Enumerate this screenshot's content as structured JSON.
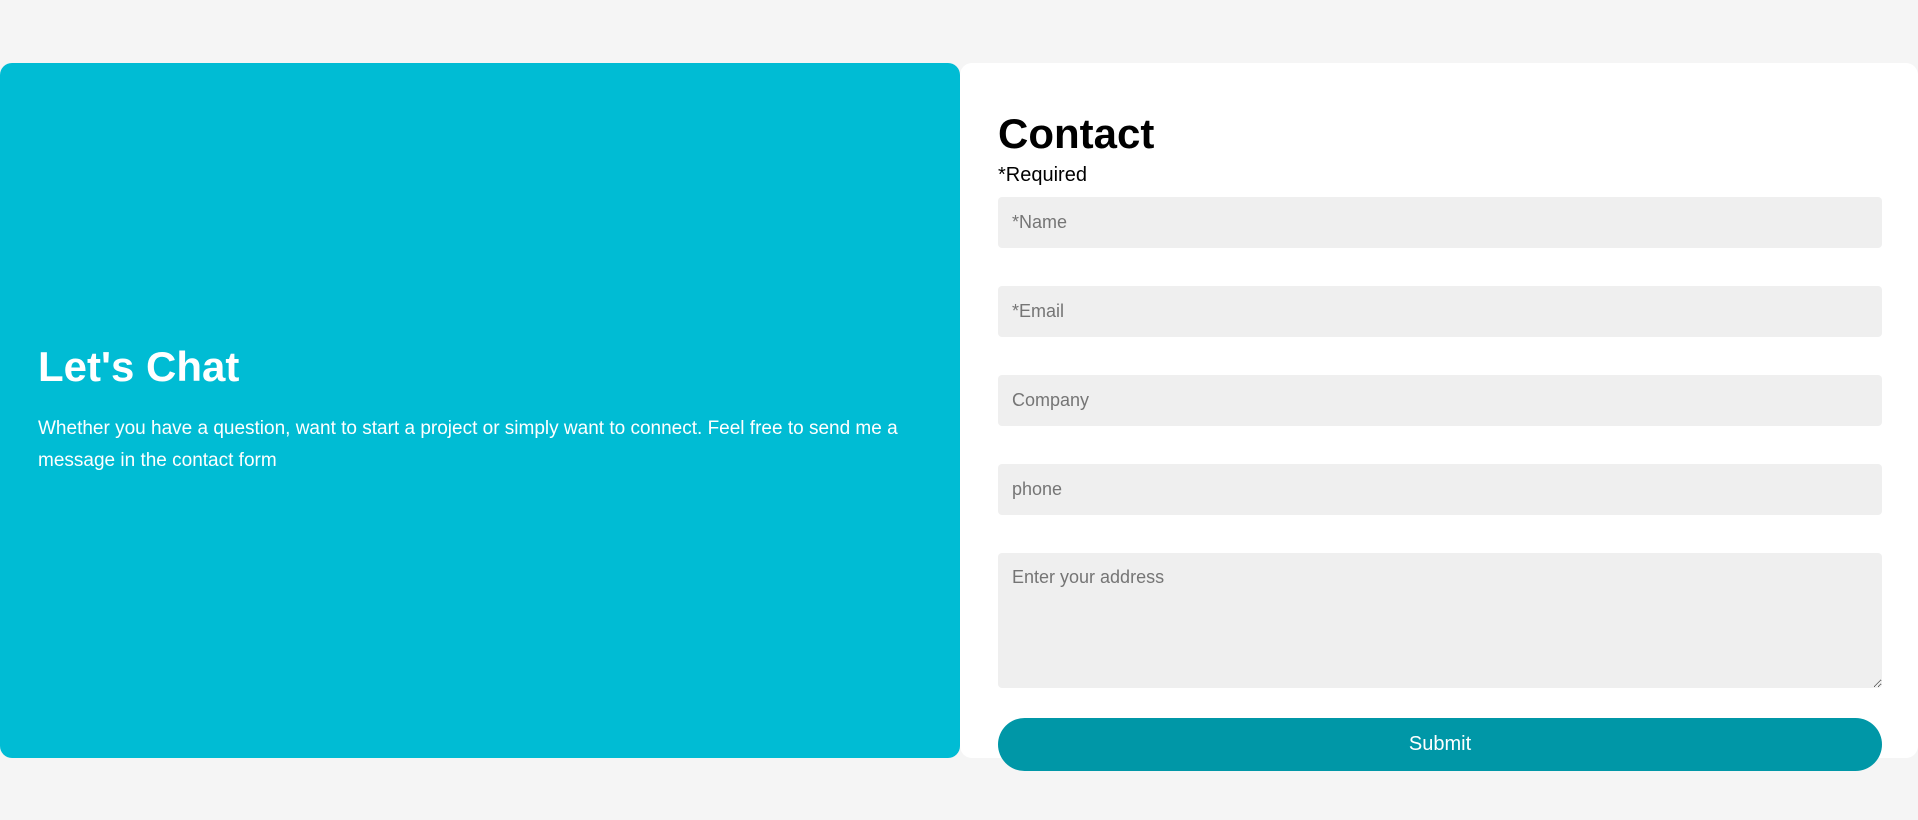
{
  "chat": {
    "title": "Let's Chat",
    "text": "Whether you have a question, want to start a project or simply want to connect. Feel free to send me a message in the contact form"
  },
  "form": {
    "title": "Contact",
    "required_note": "*Required",
    "name_placeholder": "*Name",
    "email_placeholder": "*Email",
    "company_placeholder": "Company",
    "phone_placeholder": "phone",
    "address_placeholder": "Enter your address",
    "submit_label": "Submit"
  },
  "colors": {
    "page_background": "#f5f5f5",
    "chat_panel": "#00bcd4",
    "submit_button": "#0097a7",
    "field_background": "#efefef"
  }
}
